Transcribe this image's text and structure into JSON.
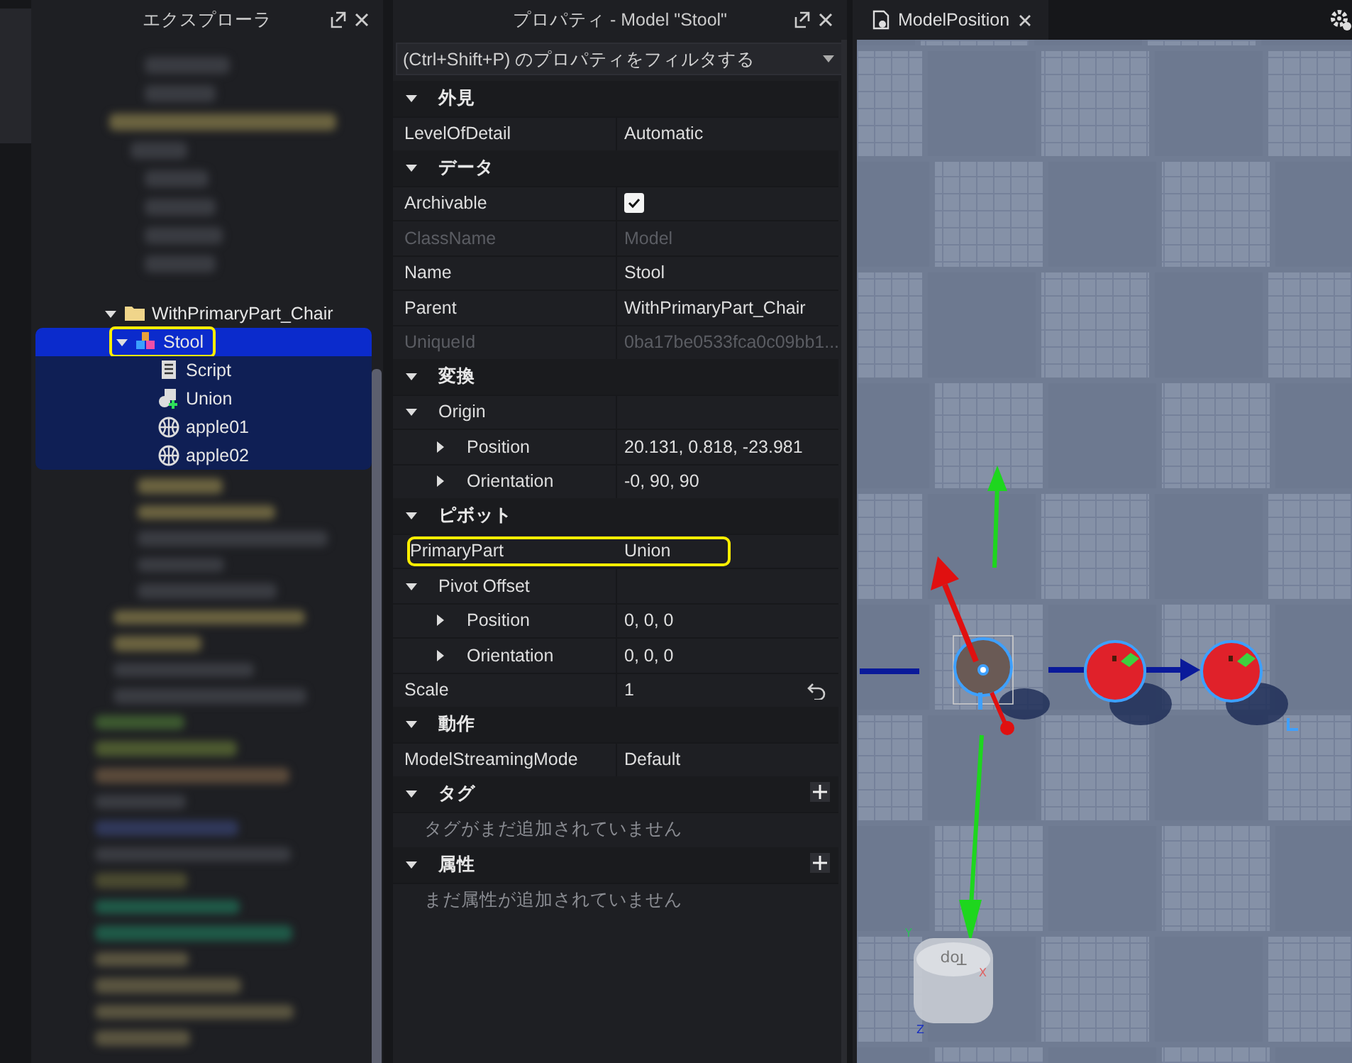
{
  "explorer": {
    "title": "エクスプローラ",
    "tree": [
      {
        "label": "WithPrimaryPart_Chair",
        "kind": "folder",
        "expanded": true,
        "selected": false,
        "highlighted": false,
        "children": [
          {
            "label": "Stool",
            "kind": "model",
            "expanded": true,
            "selected": true,
            "highlighted": true,
            "children": [
              {
                "label": "Script",
                "kind": "script",
                "selected": false,
                "highlighted": false
              },
              {
                "label": "Union",
                "kind": "union",
                "selected": false,
                "highlighted": false
              },
              {
                "label": "apple01",
                "kind": "mesh",
                "selected": false,
                "highlighted": false
              },
              {
                "label": "apple02",
                "kind": "mesh",
                "selected": false,
                "highlighted": false
              }
            ]
          }
        ]
      }
    ]
  },
  "properties": {
    "title": "プロパティ - Model \"Stool\"",
    "filter": {
      "placeholder": "(Ctrl+Shift+P) のプロパティをフィルタする"
    },
    "sections": [
      {
        "title": "外見",
        "expanded": true,
        "rows": [
          {
            "name": "LevelOfDetail",
            "value": "Automatic",
            "kind": "text",
            "disabled": false
          }
        ]
      },
      {
        "title": "データ",
        "expanded": true,
        "rows": [
          {
            "name": "Archivable",
            "kind": "checkbox",
            "checked": true,
            "disabled": false
          },
          {
            "name": "ClassName",
            "value": "Model",
            "kind": "text",
            "disabled": true
          },
          {
            "name": "Name",
            "value": "Stool",
            "kind": "text",
            "disabled": false
          },
          {
            "name": "Parent",
            "value": "WithPrimaryPart_Chair",
            "kind": "text",
            "disabled": false
          },
          {
            "name": "UniqueId",
            "value": "0ba17be0533fca0c09bb1...",
            "kind": "text",
            "disabled": true
          }
        ]
      },
      {
        "title": "変換",
        "expanded": true,
        "rows": [
          {
            "name": "Origin",
            "kind": "group",
            "expanded": true,
            "children": [
              {
                "name": "Position",
                "value": "20.131, 0.818, -23.981",
                "kind": "text",
                "expanded": false,
                "disabled": false
              },
              {
                "name": "Orientation",
                "value": "-0, 90, 90",
                "kind": "text",
                "expanded": false,
                "disabled": false
              }
            ]
          }
        ]
      },
      {
        "title": "ピボット",
        "expanded": true,
        "rows": [
          {
            "name": "PrimaryPart",
            "value": "Union",
            "kind": "text",
            "disabled": false,
            "highlighted": true
          },
          {
            "name": "Pivot Offset",
            "kind": "group",
            "expanded": true,
            "children": [
              {
                "name": "Position",
                "value": "0, 0, 0",
                "kind": "text",
                "expanded": false,
                "disabled": false
              },
              {
                "name": "Orientation",
                "value": "0, 0, 0",
                "kind": "text",
                "expanded": false,
                "disabled": false
              }
            ]
          },
          {
            "name": "Scale",
            "value": "1",
            "kind": "text",
            "disabled": false,
            "resettable": true
          }
        ]
      },
      {
        "title": "動作",
        "expanded": true,
        "rows": [
          {
            "name": "ModelStreamingMode",
            "value": "Default",
            "kind": "text",
            "disabled": false
          }
        ]
      },
      {
        "title": "タグ",
        "expanded": true,
        "addable": true,
        "empty_text": "タグがまだ追加されていません"
      },
      {
        "title": "属性",
        "expanded": true,
        "addable": true,
        "empty_text": "まだ属性が追加されていません"
      }
    ]
  },
  "viewport": {
    "tab": {
      "label": "ModelPosition"
    },
    "view_cube": {
      "label": "Top",
      "axes": [
        "Y",
        "X",
        "Z"
      ]
    }
  }
}
